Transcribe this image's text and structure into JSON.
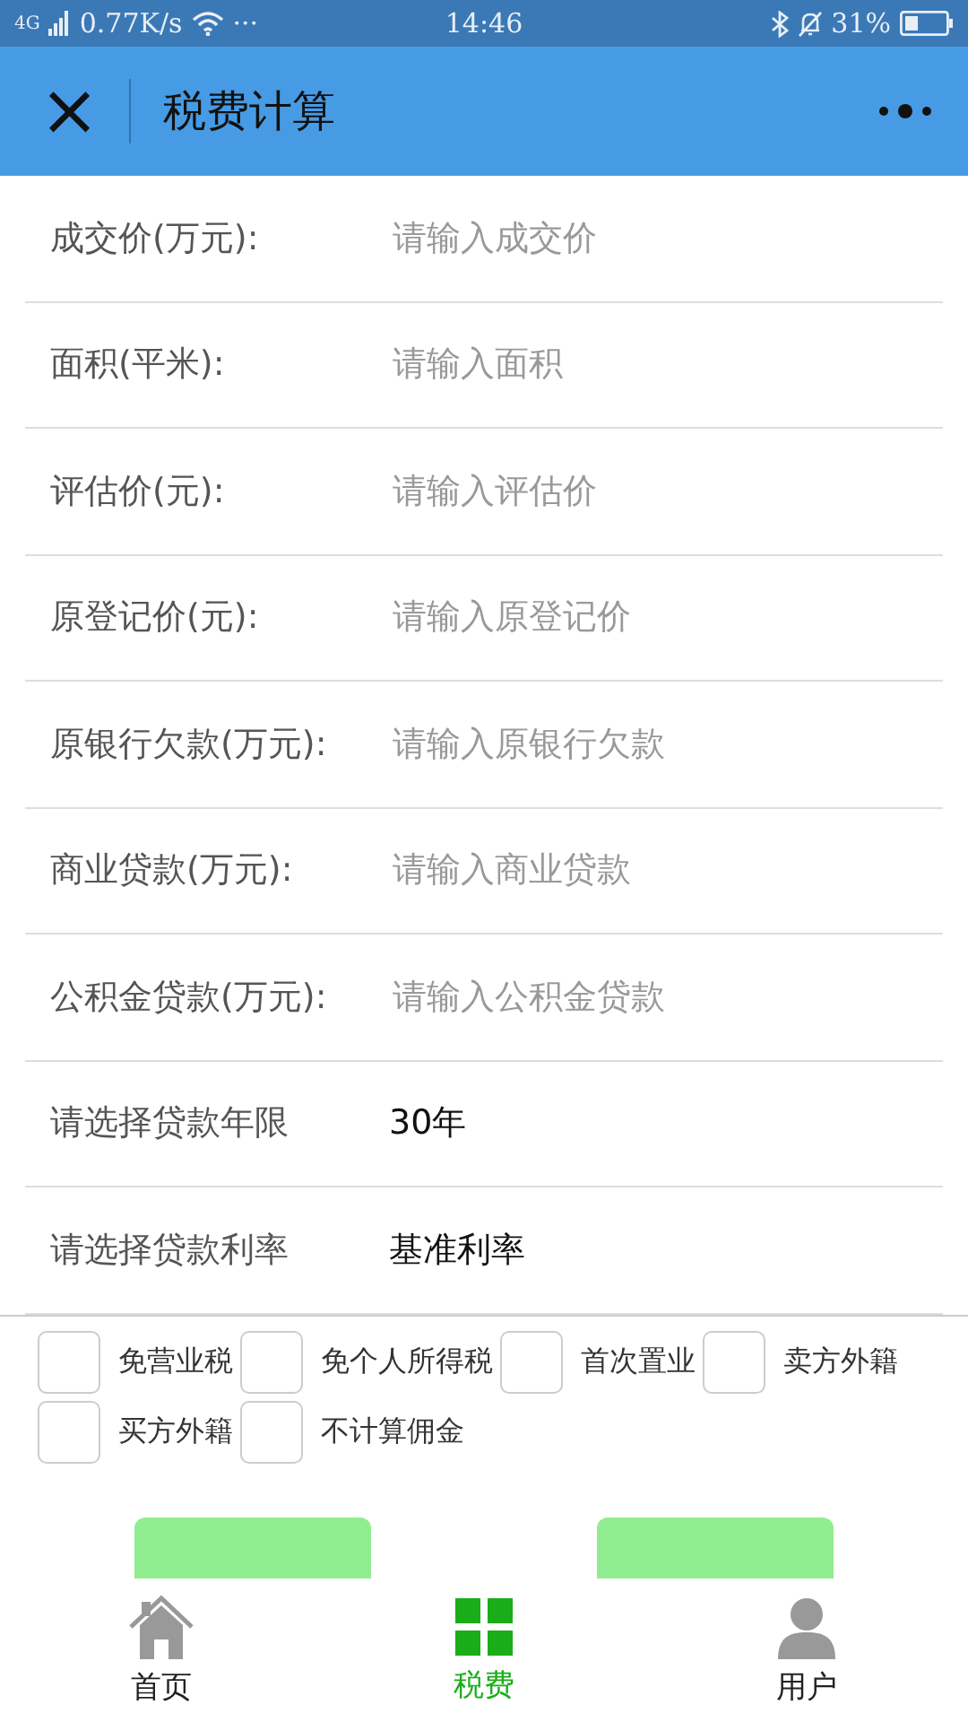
{
  "status_bar": {
    "network": "4G",
    "speed": "0.77K/s",
    "more": "···",
    "time": "14:46",
    "battery": "31%"
  },
  "nav": {
    "close": "×",
    "title": "税费计算"
  },
  "fields": [
    {
      "kind": "input",
      "label": "成交价(万元):",
      "placeholder": "请输入成交价"
    },
    {
      "kind": "input",
      "label": "面积(平米):",
      "placeholder": "请输入面积"
    },
    {
      "kind": "input",
      "label": "评估价(元):",
      "placeholder": "请输入评估价"
    },
    {
      "kind": "input",
      "label": "原登记价(元):",
      "placeholder": "请输入原登记价"
    },
    {
      "kind": "input",
      "label": "原银行欠款(万元):",
      "placeholder": "请输入原银行欠款"
    },
    {
      "kind": "input",
      "label": "商业贷款(万元):",
      "placeholder": "请输入商业贷款"
    },
    {
      "kind": "input",
      "label": "公积金贷款(万元):",
      "placeholder": "请输入公积金贷款"
    },
    {
      "kind": "picker",
      "label": "请选择贷款年限",
      "value": "30年"
    },
    {
      "kind": "picker",
      "label": "请选择贷款利率",
      "value": "基准利率"
    }
  ],
  "options": [
    {
      "label": "免营业税",
      "checked": false
    },
    {
      "label": "免个人所得税",
      "checked": false
    },
    {
      "label": "首次置业",
      "checked": false
    },
    {
      "label": "卖方外籍",
      "checked": false
    },
    {
      "label": "买方外籍",
      "checked": false
    },
    {
      "label": "不计算佣金",
      "checked": false
    }
  ],
  "buttons": [
    {
      "kind": "button"
    },
    {
      "kind": "button"
    }
  ],
  "tabs": [
    {
      "label": "首页",
      "kind": "home",
      "selected": false
    },
    {
      "label": "税费",
      "kind": "grid",
      "selected": true
    },
    {
      "label": "用户",
      "kind": "user",
      "selected": false
    }
  ]
}
